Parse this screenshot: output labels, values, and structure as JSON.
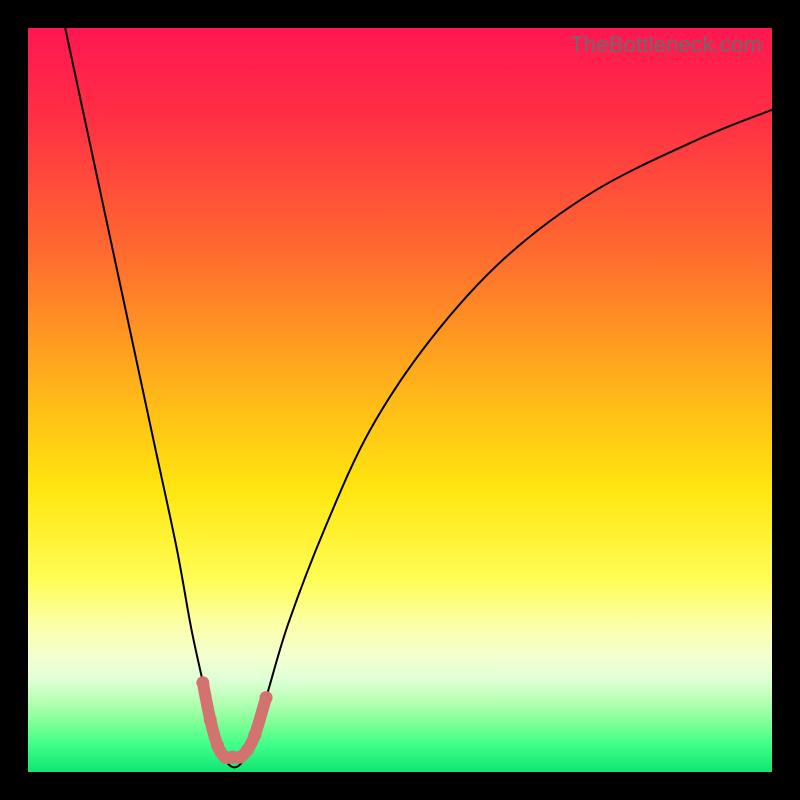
{
  "watermark": "TheBottleneck.com",
  "chart_data": {
    "type": "line",
    "title": "",
    "xlabel": "",
    "ylabel": "",
    "xlim": [
      0,
      100
    ],
    "ylim": [
      0,
      100
    ],
    "gradient_stops": [
      {
        "offset": 0.0,
        "color": "#ff1751"
      },
      {
        "offset": 0.12,
        "color": "#ff2f45"
      },
      {
        "offset": 0.3,
        "color": "#ff6a2f"
      },
      {
        "offset": 0.48,
        "color": "#ffb21a"
      },
      {
        "offset": 0.62,
        "color": "#ffe60f"
      },
      {
        "offset": 0.74,
        "color": "#fffd55"
      },
      {
        "offset": 0.8,
        "color": "#fbffa6"
      },
      {
        "offset": 0.845,
        "color": "#f4ffcf"
      },
      {
        "offset": 0.875,
        "color": "#e0ffd6"
      },
      {
        "offset": 0.905,
        "color": "#b7ffb4"
      },
      {
        "offset": 0.935,
        "color": "#7dff95"
      },
      {
        "offset": 0.965,
        "color": "#3cff87"
      },
      {
        "offset": 1.0,
        "color": "#10e574"
      }
    ],
    "series": [
      {
        "name": "bottleneck-curve",
        "stroke": "#000000",
        "stroke_width": 2,
        "x": [
          5,
          8,
          11,
          14,
          17,
          20,
          22,
          24,
          25.5,
          27,
          28.5,
          30,
          32,
          35,
          40,
          46,
          54,
          64,
          76,
          90,
          100
        ],
        "y": [
          100,
          86,
          72,
          58,
          44,
          30,
          19,
          10,
          4,
          1,
          1,
          4,
          10,
          20,
          33,
          46,
          58,
          69,
          78,
          85,
          89
        ]
      },
      {
        "name": "highlight-band",
        "stroke": "#d2736f",
        "stroke_width": 12,
        "linecap": "round",
        "x": [
          23.5,
          24.5,
          25.5,
          26.5,
          27.5,
          28.5,
          29.5,
          30.5,
          32.0
        ],
        "y": [
          12,
          7,
          3.5,
          2,
          2,
          2,
          3,
          5,
          10
        ]
      }
    ],
    "annotations": []
  }
}
